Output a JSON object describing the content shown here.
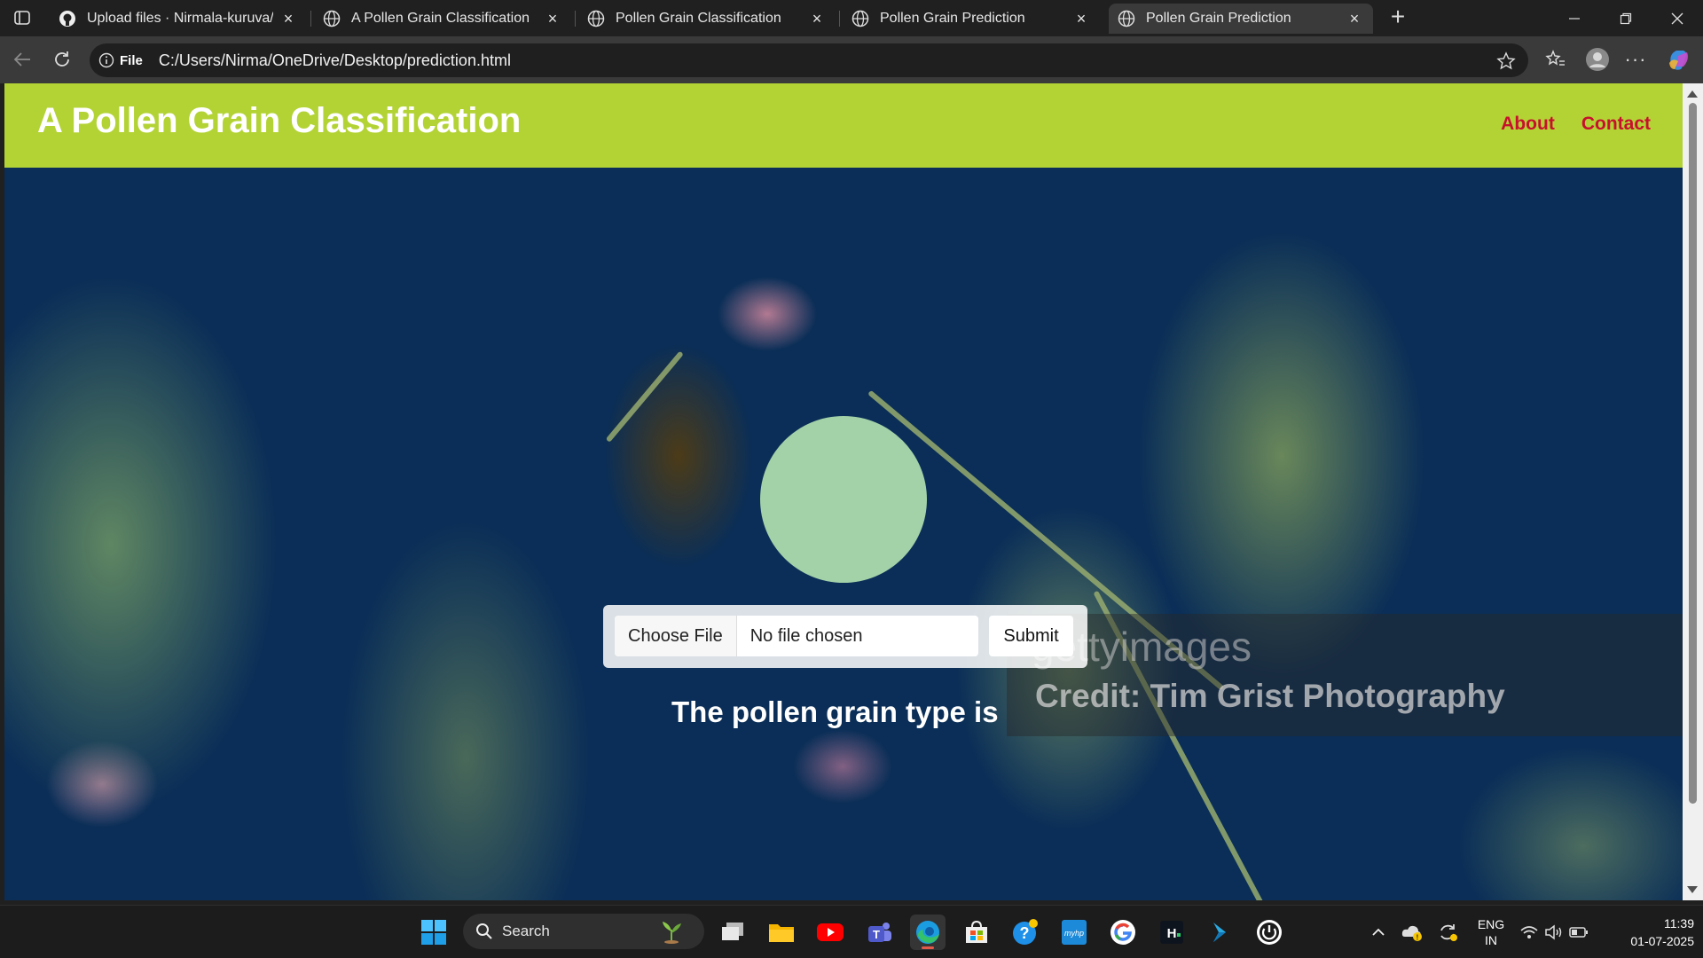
{
  "browser": {
    "tabs": [
      {
        "title": "Upload files · Nirmala-kuruva/poll",
        "icon": "github-icon",
        "active": false
      },
      {
        "title": "A Pollen Grain Classification",
        "icon": "globe-icon",
        "active": false
      },
      {
        "title": "Pollen Grain Classification",
        "icon": "globe-icon",
        "active": false
      },
      {
        "title": "Pollen Grain Prediction",
        "icon": "globe-icon",
        "active": false
      },
      {
        "title": "Pollen Grain Prediction",
        "icon": "globe-icon",
        "active": true
      }
    ],
    "address": {
      "scheme_label": "File",
      "url": "C:/Users/Nirma/OneDrive/Desktop/prediction.html"
    }
  },
  "page": {
    "header": {
      "title": "A Pollen Grain Classification",
      "nav": [
        "About",
        "Contact"
      ]
    },
    "form": {
      "choose_label": "Choose File",
      "file_status": "No file chosen",
      "submit_label": "Submit"
    },
    "result_text": "The pollen grain type is",
    "watermark": {
      "logo": "gettyimages",
      "credit": "Credit: Tim Grist Photography"
    },
    "colors": {
      "header_bg": "#b3d335",
      "nav_link": "#c8102e",
      "preview_circle": "#a3d1a8"
    }
  },
  "taskbar": {
    "search_label": "Search",
    "apps": [
      "windows-start-icon",
      "task-view-icon",
      "file-explorer-icon",
      "youtube-icon",
      "teams-icon",
      "edge-icon",
      "store-icon",
      "help-icon",
      "myhp-icon",
      "google-icon",
      "hackerrank-icon",
      "dev-icon",
      "power-icon"
    ],
    "tray": {
      "lang_line1": "ENG",
      "lang_line2": "IN",
      "time": "11:39",
      "date": "01-07-2025"
    }
  }
}
